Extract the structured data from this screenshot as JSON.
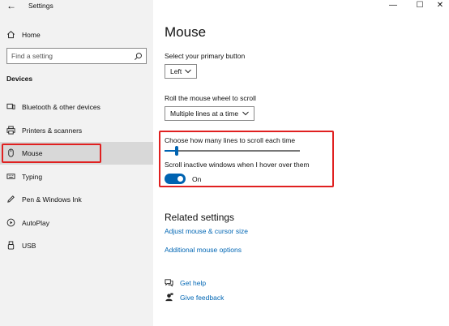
{
  "window": {
    "title": "Settings",
    "back_glyph": "←",
    "controls": {
      "minimize": "—",
      "maximize": "☐",
      "close": "✕"
    }
  },
  "sidebar": {
    "home_label": "Home",
    "search_placeholder": "Find a setting",
    "section_heading": "Devices",
    "items": [
      {
        "label": "Bluetooth & other devices",
        "icon": "bluetooth-devices-icon"
      },
      {
        "label": "Printers & scanners",
        "icon": "printer-icon"
      },
      {
        "label": "Mouse",
        "icon": "mouse-icon",
        "selected": true
      },
      {
        "label": "Typing",
        "icon": "keyboard-icon"
      },
      {
        "label": "Pen & Windows Ink",
        "icon": "pen-icon"
      },
      {
        "label": "AutoPlay",
        "icon": "autoplay-icon"
      },
      {
        "label": "USB",
        "icon": "usb-icon"
      }
    ]
  },
  "main": {
    "title": "Mouse",
    "primary_button": {
      "label": "Select your primary button",
      "value": "Left"
    },
    "wheel_scroll": {
      "label": "Roll the mouse wheel to scroll",
      "value": "Multiple lines at a time"
    },
    "lines_to_scroll": {
      "label": "Choose how many lines to scroll each time",
      "value_fraction": 0.09
    },
    "scroll_inactive": {
      "label": "Scroll inactive windows when I hover over them",
      "state": "On"
    },
    "related": {
      "title": "Related settings",
      "links": [
        "Adjust mouse & cursor size",
        "Additional mouse options"
      ]
    },
    "help": {
      "get_help": "Get help",
      "give_feedback": "Give feedback"
    }
  },
  "colors": {
    "accent": "#0063b1",
    "link": "#0066b4",
    "annotation_red": "#e02020",
    "sidebar_bg": "#f2f2f2"
  }
}
